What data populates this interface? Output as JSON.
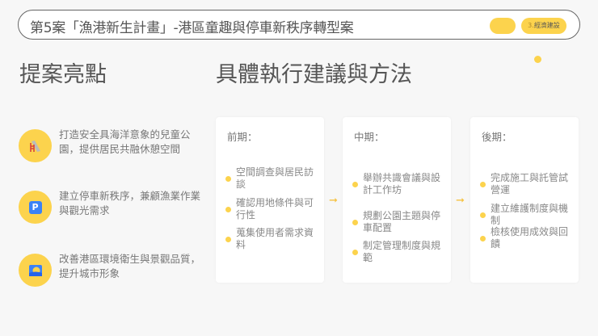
{
  "header": {
    "title": "第5案「漁港新生計畫」-港區童趣與停車新秩序轉型案",
    "tag_number": "3.",
    "tag_label": "經濟建設"
  },
  "left": {
    "heading": "提案亮點",
    "items": [
      {
        "icon": "slide-icon",
        "text": "打造安全具海洋意象的兒童公園，提供居民共融休憩空間"
      },
      {
        "icon": "parking-icon",
        "text": "建立停車新秩序，兼顧漁業作業與觀光需求"
      },
      {
        "icon": "sunrise-icon",
        "text": "改善港區環境衛生與景觀品質，提升城市形象"
      }
    ]
  },
  "right": {
    "heading": "具體執行建議與方法",
    "phases": [
      {
        "title": "前期：",
        "items": [
          "空間調查與居民訪談",
          "確認用地條件與可行性",
          "蒐集使用者需求資料"
        ]
      },
      {
        "title": "中期：",
        "items": [
          "舉辦共識會議與設計工作坊",
          "規劃公園主題與停車配置",
          "制定管理制度與規範"
        ]
      },
      {
        "title": "後期：",
        "items": [
          "完成施工與託管試營運",
          "建立維護制度與機制",
          "檢核使用成效與回饋"
        ]
      }
    ]
  },
  "colors": {
    "accent": "#fcd34d"
  }
}
